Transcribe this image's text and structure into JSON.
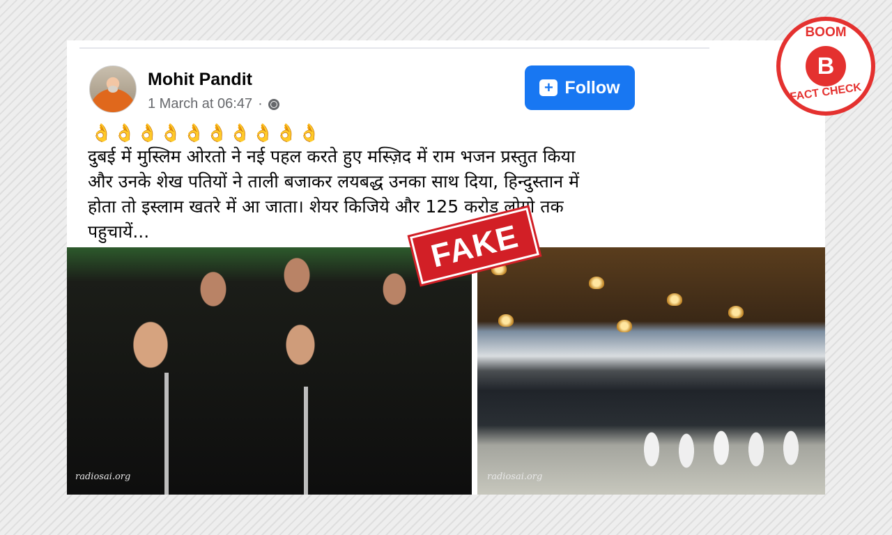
{
  "post": {
    "author": "Mohit Pandit",
    "timestamp": "1 March at 06:47",
    "separator": "·",
    "visibility_icon": "globe-icon",
    "follow_label": "Follow",
    "emojis": "👌👌👌👌👌👌👌👌👌👌",
    "text_lines": [
      "दुबई में मुस्लिम ओरतो ने नई पहल करते हुए मस्ज़िद में राम भजन प्रस्तुत किया",
      "और उनके शेख पतियों ने ताली बजाकर लयबद्ध उनका साथ दिया, हिन्दुस्तान में",
      "होता तो इस्लाम खतरे में आ जाता। शेयर किजिये और 125 करोड लोगो तक",
      "पहुचायें..."
    ]
  },
  "media": {
    "left_watermark": "radiosai.org",
    "right_watermark": "radiosai.org"
  },
  "overlay": {
    "fake_label": "FAKE",
    "badge_top": "BOOM",
    "badge_letter": "B",
    "badge_bottom": "FACT CHECK"
  },
  "colors": {
    "follow_button": "#1877f2",
    "fake_stamp": "#d21f26",
    "boom_red": "#e4312f"
  }
}
